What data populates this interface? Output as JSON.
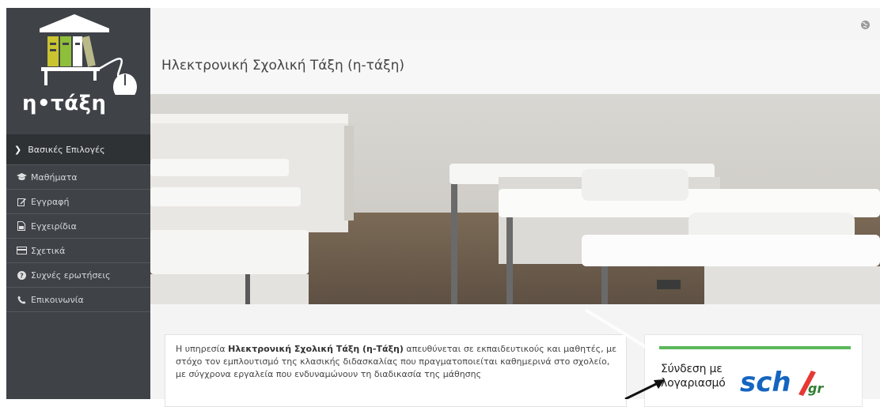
{
  "logo": {
    "text": "η•τάξη"
  },
  "sidebar": {
    "section_title": "Βασικές Επιλογές",
    "items": [
      {
        "label": "Μαθήματα",
        "icon": "graduation-cap-icon"
      },
      {
        "label": "Εγγραφή",
        "icon": "edit-icon"
      },
      {
        "label": "Εγχειρίδια",
        "icon": "document-icon"
      },
      {
        "label": "Σχετικά",
        "icon": "id-card-icon"
      },
      {
        "label": "Συχνές ερωτήσεις",
        "icon": "question-circle-icon"
      },
      {
        "label": "Επικοινωνία",
        "icon": "phone-icon"
      }
    ]
  },
  "header": {
    "title": "Ηλεκτρονική Σχολική Τάξη (η-τάξη)",
    "language_icon": "globe-icon"
  },
  "info": {
    "prefix": "Η υπηρεσία ",
    "bold": "Ηλεκτρονική Σχολική Τάξη (η-Τάξη)",
    "suffix": " απευθύνεται σε εκπαιδευτικούς και μαθητές, με στόχο τον εμπλουτισμό της κλασικής διδασκαλίας που πραγματοποιείται καθημερινά στο σχολείο, με σύγχρονα εργαλεία που ενδυναμώνουν τη διαδικασία της μάθησης"
  },
  "login": {
    "line1": "Σύνδεση με",
    "line2": "λογαριασμό",
    "brand": "sch",
    "brand_suffix": "gr"
  },
  "colors": {
    "sidebar": "#3f4247",
    "accent_green": "#5cb85c",
    "sch_blue": "#1565c0",
    "sch_red": "#e53935"
  }
}
